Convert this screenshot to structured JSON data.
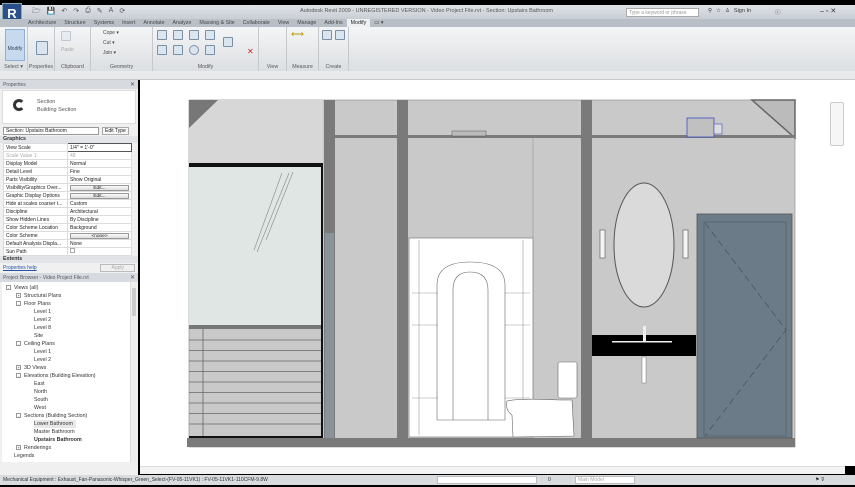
{
  "app": {
    "title": "Autodesk Revit 2009 - UNREGISTERED VERSION - Video Project File.rvt - Section: Upstairs Bathroom",
    "logo": "R",
    "search_placeholder": "Type a keyword or phrase",
    "sign_in": "Sign In"
  },
  "tabs": [
    "Architecture",
    "Structure",
    "Systems",
    "Insert",
    "Annotate",
    "Analyze",
    "Massing & Site",
    "Collaborate",
    "View",
    "Manage",
    "Add-Ins",
    "Modify",
    "▭ ▾"
  ],
  "active_tab": "Modify",
  "ribbon": {
    "panels": [
      "Select ▾",
      "Properties",
      "Clipboard",
      "Geometry",
      "Modify",
      "View",
      "Measure",
      "Create"
    ],
    "modify_button": "Modify",
    "paste": "Paste",
    "cope": "Cope ▾",
    "cut": "Cut ▾",
    "join": "Join ▾"
  },
  "properties": {
    "header": "Properties",
    "type_name": "Section",
    "type_sub": "Building Section",
    "instance": "Section: Upstairs Bathroom",
    "edit_type": "Edit Type",
    "group_graphics": "Graphics",
    "rows": [
      [
        "View Scale",
        "1/4\" = 1'-0\""
      ],
      [
        "Scale Value  1:",
        "48"
      ],
      [
        "Display Model",
        "Normal"
      ],
      [
        "Detail Level",
        "Fine"
      ],
      [
        "Parts Visibility",
        "Show Original"
      ],
      [
        "Visibility/Graphics Over...",
        "Edit..."
      ],
      [
        "Graphic Display Options",
        "Edit..."
      ],
      [
        "Hide at scales coarser t...",
        "Custom"
      ],
      [
        "Discipline",
        "Architectural"
      ],
      [
        "Show Hidden Lines",
        "By Discipline"
      ],
      [
        "Color Scheme Location",
        "Background"
      ],
      [
        "Color Scheme",
        "<none>"
      ],
      [
        "Default Analysis Displa...",
        "None"
      ],
      [
        "Sun Path",
        ""
      ]
    ],
    "group_extents": "Extents",
    "help": "Properties help",
    "apply": "Apply"
  },
  "browser": {
    "header": "Project Browser - Video Project File.rvt",
    "items": [
      {
        "label": "Views (all)",
        "level": 0,
        "pm": "-"
      },
      {
        "label": "Structural Plans",
        "level": 1,
        "pm": "+"
      },
      {
        "label": "Floor Plans",
        "level": 1,
        "pm": "-"
      },
      {
        "label": "Level 1",
        "level": 2
      },
      {
        "label": "Level 2",
        "level": 2
      },
      {
        "label": "Level 8",
        "level": 2
      },
      {
        "label": "Site",
        "level": 2
      },
      {
        "label": "Ceiling Plans",
        "level": 1,
        "pm": "-"
      },
      {
        "label": "Level 1",
        "level": 2
      },
      {
        "label": "Level 2",
        "level": 2
      },
      {
        "label": "3D Views",
        "level": 1,
        "pm": "+"
      },
      {
        "label": "Elevations (Building Elevation)",
        "level": 1,
        "pm": "-"
      },
      {
        "label": "East",
        "level": 2
      },
      {
        "label": "North",
        "level": 2
      },
      {
        "label": "South",
        "level": 2
      },
      {
        "label": "West",
        "level": 2
      },
      {
        "label": "Sections (Building Section)",
        "level": 1,
        "pm": "-"
      },
      {
        "label": "Lower Bathroom",
        "level": 2,
        "state": "sel"
      },
      {
        "label": "Master Bathroom",
        "level": 2
      },
      {
        "label": "Upstairs Bathroom",
        "level": 2,
        "state": "bold"
      },
      {
        "label": "Renderings",
        "level": 1,
        "pm": "+"
      },
      {
        "label": "Legends",
        "level": 0
      }
    ]
  },
  "status": {
    "text": "Mechanical Equipment : Exhaust_Fan-Panasonic-Whisper_Green_Select-(FV-05-11VK1) : FV-05-11VK1-110CFM-9.8W",
    "coord": "0",
    "model": "Main Model"
  },
  "colors": {
    "accent": "#c6d9ee",
    "door": "#6b7b87",
    "wall": "#c8c8c8",
    "column": "#7a7a7a"
  }
}
